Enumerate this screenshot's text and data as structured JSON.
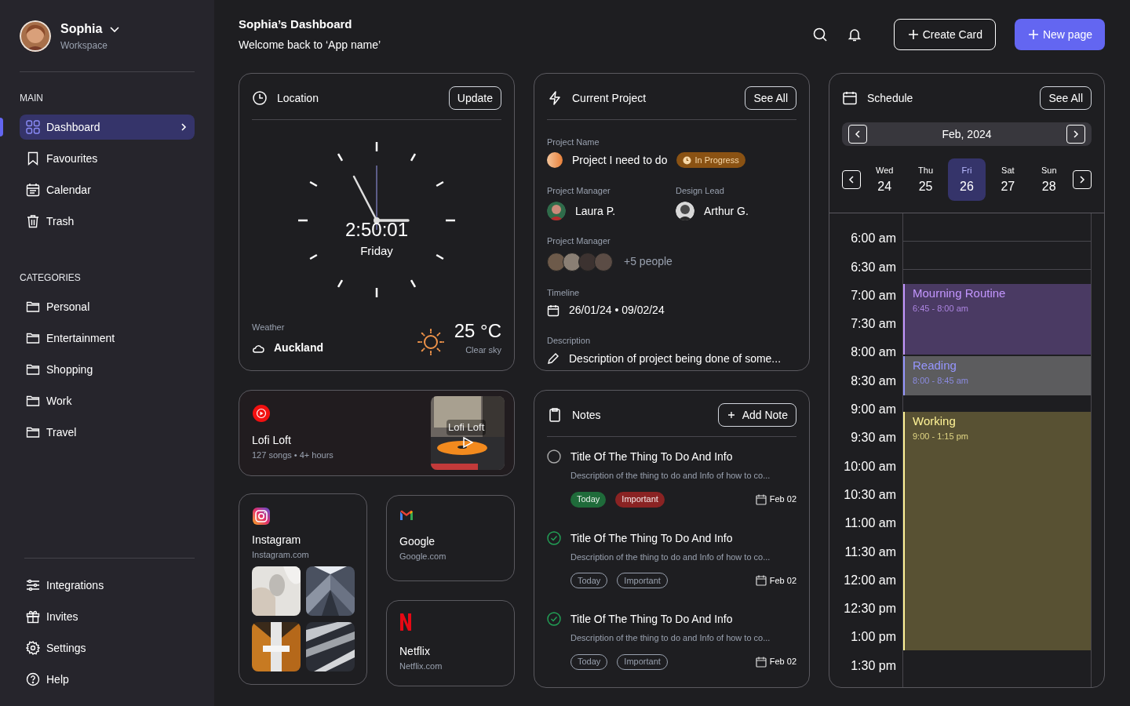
{
  "profile": {
    "name": "Sophia",
    "subtitle": "Workspace"
  },
  "sidebar": {
    "main_label": "MAIN",
    "main_items": [
      {
        "label": "Dashboard",
        "selected": true
      },
      {
        "label": "Favourites",
        "selected": false
      },
      {
        "label": "Calendar",
        "selected": false
      },
      {
        "label": "Trash",
        "selected": false
      }
    ],
    "categories_label": "CATEGORIES",
    "categories": [
      {
        "label": "Personal"
      },
      {
        "label": "Entertainment"
      },
      {
        "label": "Shopping"
      },
      {
        "label": "Work"
      },
      {
        "label": "Travel"
      }
    ],
    "bottom_items": [
      {
        "label": "Integrations"
      },
      {
        "label": "Invites"
      },
      {
        "label": "Settings"
      },
      {
        "label": "Help"
      }
    ]
  },
  "header": {
    "title": "Sophia’s Dashboard",
    "subtitle": "Welcome back to ‘App name’",
    "buttons": [
      "Create Card",
      "New page"
    ]
  },
  "location": {
    "title": "Location",
    "button": "Update",
    "time": "2:50:01",
    "day": "Friday",
    "weather_label": "Weather",
    "city": "Auckland",
    "temperature": "25 °C",
    "condition": "Clear sky"
  },
  "music": {
    "title": "Lofi Loft",
    "meta": "127 songs • 4+ hours",
    "thumb_caption": "Lofi Loft"
  },
  "links": [
    {
      "title": "Instagram",
      "url": "Instagram.com"
    },
    {
      "title": "Google",
      "url": "Google.com"
    },
    {
      "title": "Netflix",
      "url": "Netflix.com"
    }
  ],
  "project": {
    "title": "Current Project",
    "button": "See All",
    "name_label": "Project Name",
    "name": "Project I need to do",
    "status": "In Progress",
    "manager_label": "Project Manager",
    "manager": "Laura P.",
    "lead_label": "Design Lead",
    "lead": "Arthur G.",
    "team_label": "Project Manager",
    "team_more": "+5 people",
    "timeline_label": "Timeline",
    "timeline": "26/01/24 • 09/02/24",
    "description_label": "Description",
    "description": "Description of project being done of some..."
  },
  "notes": {
    "title": "Notes",
    "button": "Add Note",
    "items": [
      {
        "title": "Title Of The Thing To Do And Info",
        "description": "Description of the thing to do and Info of how to co...",
        "checked": false,
        "date": "Feb 02",
        "tags": [
          {
            "label": "Today",
            "filled": true,
            "color": "#1f6b3a"
          },
          {
            "label": "Important",
            "filled": true,
            "color": "#8a2323"
          }
        ]
      },
      {
        "title": "Title Of The Thing To Do And Info",
        "description": "Description of the thing to do and Info of how to co...",
        "checked": true,
        "date": "Feb 02",
        "tags": [
          {
            "label": "Today",
            "filled": false
          },
          {
            "label": "Important",
            "filled": false
          }
        ]
      },
      {
        "title": "Title Of The Thing To Do And Info",
        "description": "Description of the thing to do and Info of how to co...",
        "checked": true,
        "date": "Feb 02",
        "tags": [
          {
            "label": "Today",
            "filled": false
          },
          {
            "label": "Important",
            "filled": false
          }
        ]
      }
    ]
  },
  "schedule": {
    "title": "Schedule",
    "button": "See All",
    "month": "Feb, 2024",
    "days": [
      {
        "weekday": "Wed",
        "date": "24",
        "selected": false
      },
      {
        "weekday": "Thu",
        "date": "25",
        "selected": false
      },
      {
        "weekday": "Fri",
        "date": "26",
        "selected": true
      },
      {
        "weekday": "Sat",
        "date": "27",
        "selected": false
      },
      {
        "weekday": "Sun",
        "date": "28",
        "selected": false
      }
    ],
    "times": [
      "6:00 am",
      "6:30 am",
      "7:00 am",
      "7:30 am",
      "8:00 am",
      "8:30 am",
      "9:00 am",
      "9:30 am",
      "10:00 am",
      "10:30 am",
      "11:00 am",
      "11:30 am",
      "12:00 am",
      "12:30 pm",
      "1:00 pm",
      "1:30 pm"
    ],
    "events": [
      {
        "title": "Mourning Routine",
        "time": "6:45 - 8:00 am",
        "color": "#4a3a63"
      },
      {
        "title": "Reading",
        "time": "8:00 - 8:45 am",
        "color": "#5c5c5e"
      },
      {
        "title": "Working",
        "time": "9:00 - 1:15 pm",
        "color": "#585133"
      }
    ]
  }
}
